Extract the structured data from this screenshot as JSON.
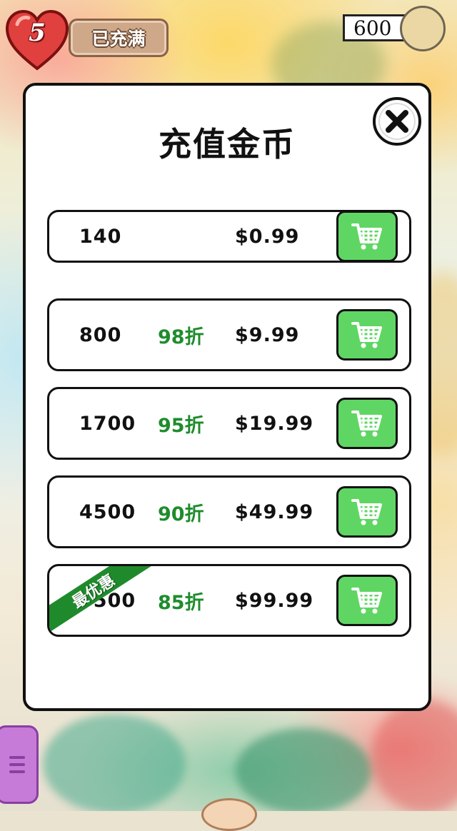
{
  "hud": {
    "lives_count": "5",
    "lives_status": "已充满",
    "coin_balance": "600"
  },
  "dialog": {
    "title": "充值金币",
    "packages": [
      {
        "amount": "140",
        "discount": "",
        "price": "$0.99",
        "ribbon": ""
      },
      {
        "amount": "800",
        "discount": "98折",
        "price": "$9.99",
        "ribbon": ""
      },
      {
        "amount": "1700",
        "discount": "95折",
        "price": "$19.99",
        "ribbon": ""
      },
      {
        "amount": "4500",
        "discount": "90折",
        "price": "$49.99",
        "ribbon": ""
      },
      {
        "amount": "9500",
        "discount": "85折",
        "price": "$99.99",
        "ribbon": "最优惠"
      }
    ]
  },
  "icons": {
    "close": "close-icon",
    "buy": "shopping-cart-icon",
    "heart": "heart-icon",
    "coin": "coin-icon"
  },
  "colors": {
    "buy_button": "#5fd664",
    "discount_text": "#1e8c2c",
    "ribbon": "#1f8a2c",
    "heart": "#e0413e"
  }
}
